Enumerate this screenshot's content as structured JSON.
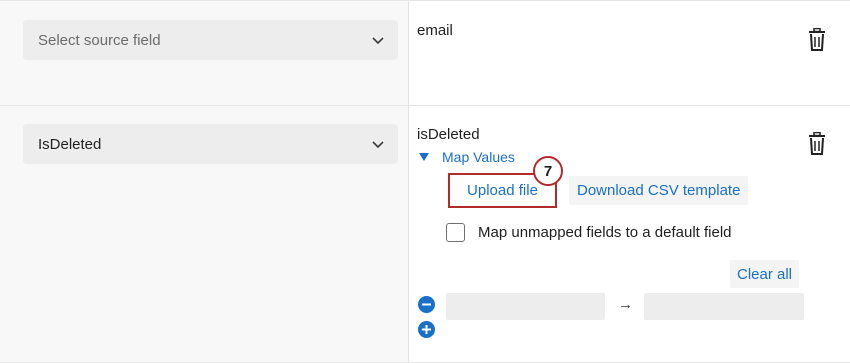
{
  "rows": [
    {
      "source_placeholder": "Select source field",
      "field_name": "email"
    },
    {
      "source_value": "IsDeleted",
      "field_name": "isDeleted",
      "map_values_label": "Map Values",
      "upload_label": "Upload file",
      "step_badge": "7",
      "download_label": "Download CSV template",
      "default_field_label": "Map unmapped fields to a default field",
      "clear_all_label": "Clear all",
      "arrow": "→"
    }
  ],
  "icons": {
    "dropdown": "chevron-down-icon",
    "delete": "trash-icon",
    "expand": "triangle-down-icon",
    "remove": "minus-circle-icon",
    "add": "plus-circle-icon"
  },
  "colors": {
    "link": "#1a6fc7",
    "highlight": "#b22a2a"
  }
}
